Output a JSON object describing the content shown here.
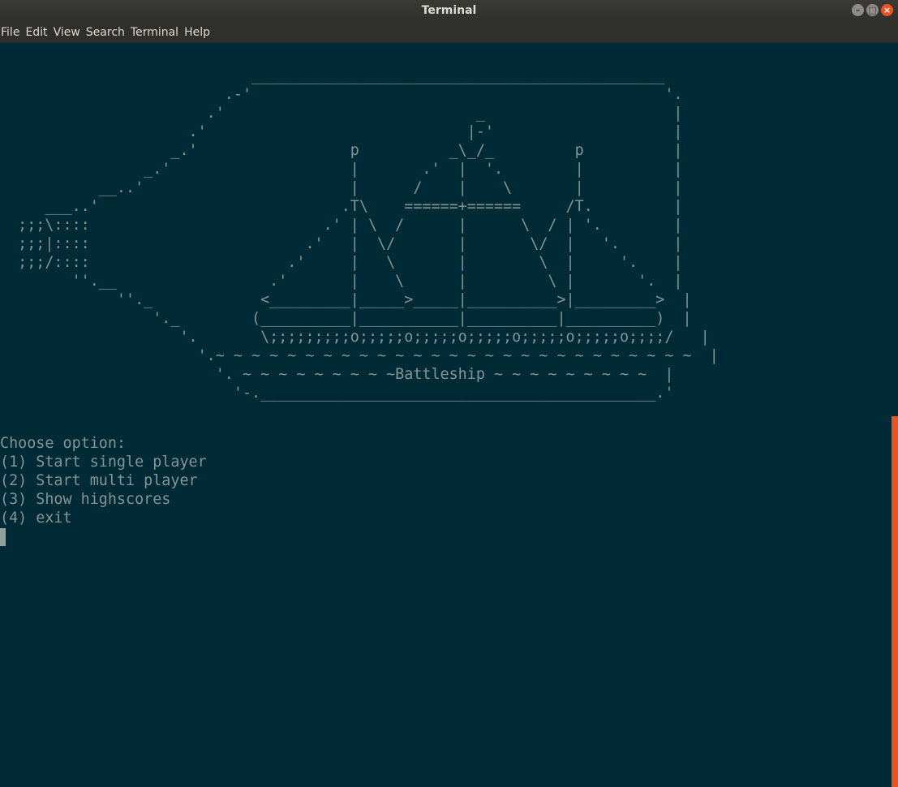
{
  "window": {
    "title": "Terminal",
    "controls": {
      "minimize": "–",
      "maximize": "□",
      "close": "×"
    }
  },
  "menubar": {
    "items": [
      "File",
      "Edit",
      "View",
      "Search",
      "Terminal",
      "Help"
    ]
  },
  "terminal": {
    "ascii_art": "                            ______________________________________________\n                         .-'                                              '.\n                       .'                            _                     |\n                     .'                             |-'                    |\n                   _.'                 p          _\\_/_         p          |\n                _.'                    |       .'  |  '.        |          |\n           __..'                       |      /    |    \\       |          |\n     ___..'                           .T\\    ======+======     /T.         |\n  ;;;\\::::                          .' | \\  /      |      \\  / | '.        |\n  ;;;|::::                        .'   |  \\/       |       \\/  |   '.      |\n  ;;;/::::                      .'     |   \\       |        \\  |     '.    |\n        ''.__                 .'       |    \\      |         \\ |       '.  |\n             ''._            <_________|_____>_____|__________>|_________>  |\n                 '._        (__________|___________|__________|__________)  |\n                    '.       \\;;;;;;;;;o;;;;;o;;;;;o;;;;;o;;;;;o;;;;;o;;;;/   |\n                      '.~ ~ ~ ~ ~ ~ ~ ~ ~ ~ ~ ~ ~ ~ ~ ~ ~ ~ ~ ~ ~ ~ ~ ~ ~ ~ ~  |\n                        '. ~ ~ ~ ~ ~ ~ ~ ~ ~Battleship ~ ~ ~ ~ ~ ~ ~ ~ ~  |\n                          '-.____________________________________________.'",
    "prompt": "Choose option:",
    "options": [
      "(1) Start single player",
      "(2) Start multi player",
      "(3) Show highscores",
      "(4) exit"
    ]
  },
  "colors": {
    "background": "#002b36",
    "foreground": "#839496",
    "accent": "#e95420"
  },
  "icons": {
    "minimize": "minimize-icon",
    "maximize": "maximize-icon",
    "close": "close-icon"
  }
}
